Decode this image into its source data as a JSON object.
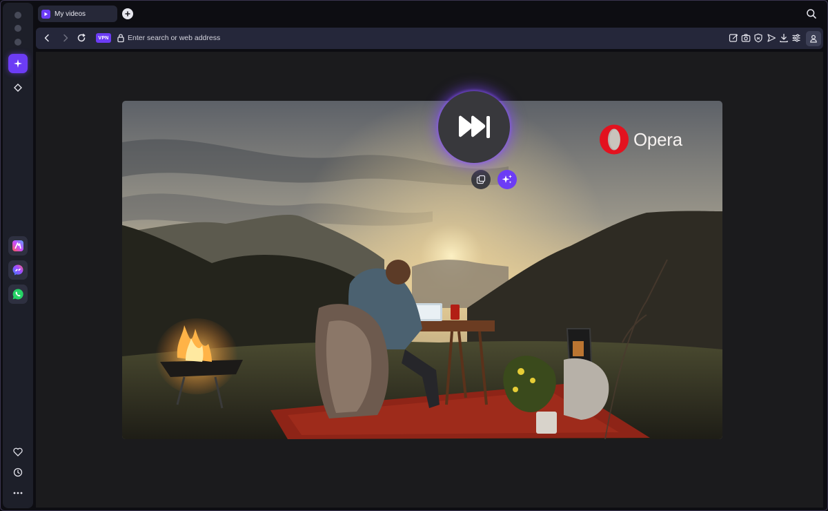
{
  "browser": {
    "name": "Opera"
  },
  "tabs": [
    {
      "title": "My videos",
      "active": true
    }
  ],
  "address_bar": {
    "placeholder": "Enter search or web address",
    "vpn_label": "VPN"
  },
  "video": {
    "brand_text": "Opera",
    "skip_icon": "skip-forward-icon"
  },
  "sidebar": {
    "apps": [
      "aria-icon",
      "messenger-icon",
      "whatsapp-icon"
    ],
    "bottom": [
      "heart-icon",
      "history-icon",
      "more-icon"
    ]
  },
  "colors": {
    "accent": "#6c3cf5",
    "opera_red": "#e3121f",
    "background": "#1b1b1d"
  }
}
